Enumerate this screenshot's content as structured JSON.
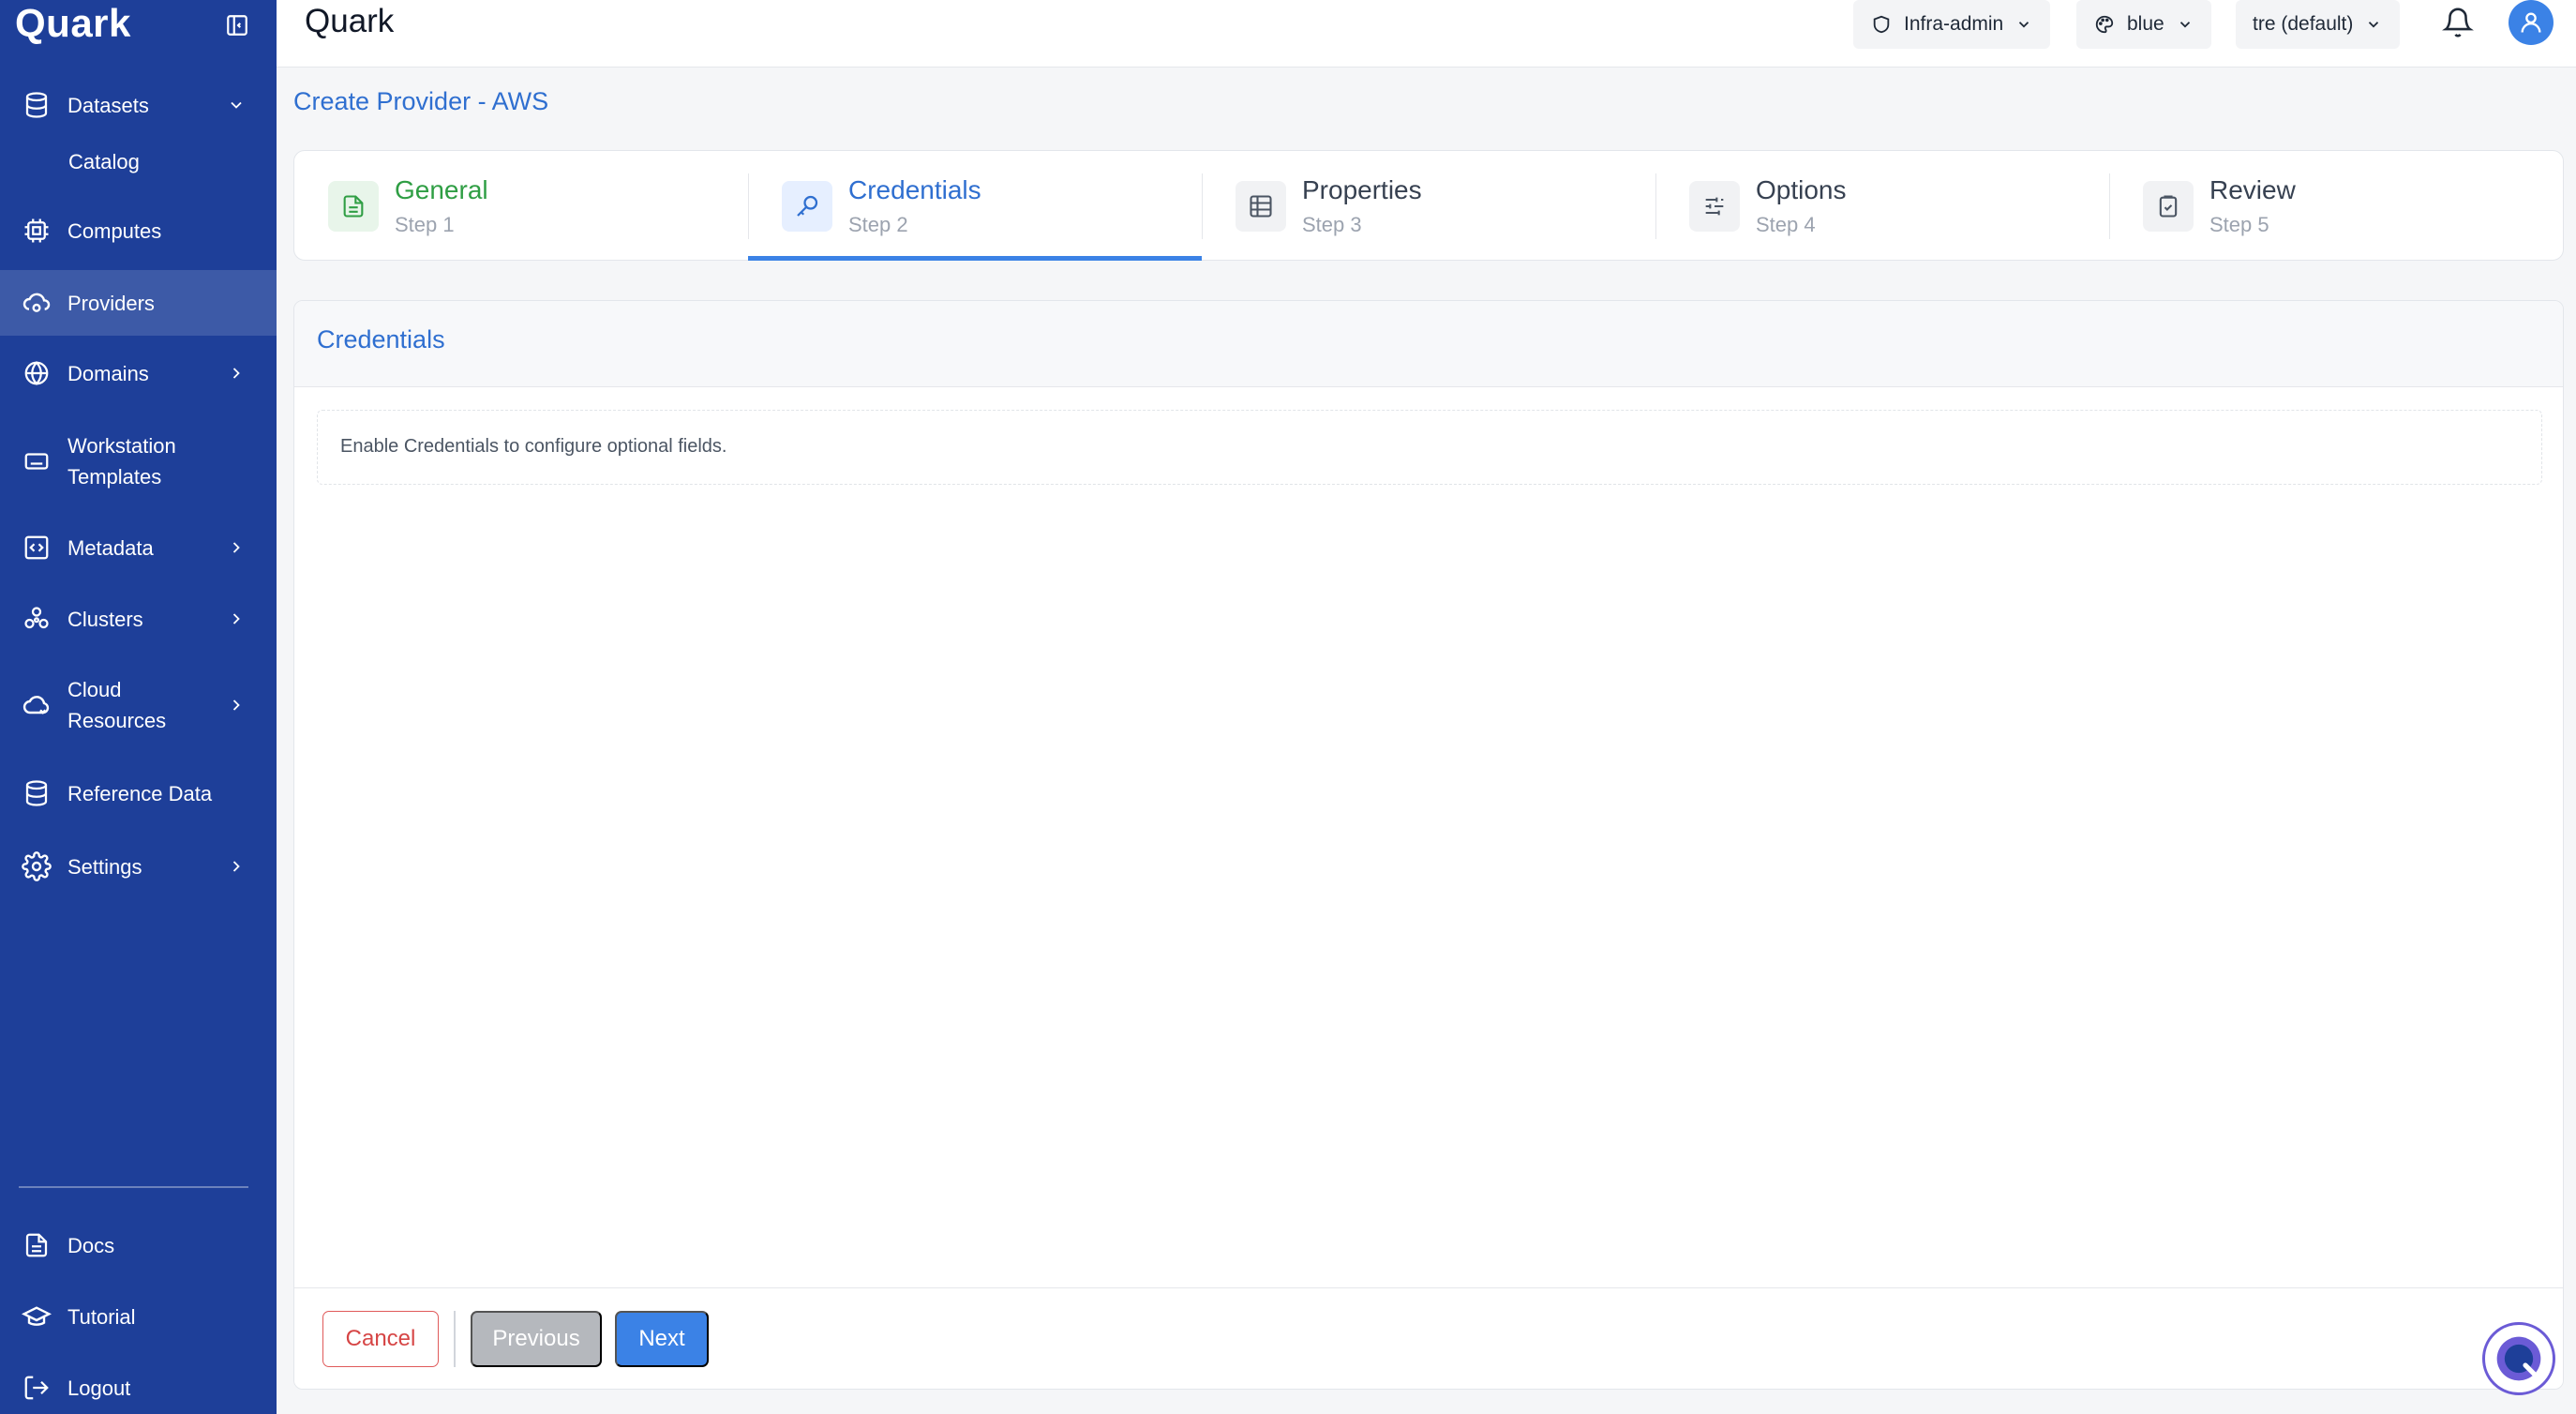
{
  "app": {
    "brand": "Quark",
    "title": "Quark"
  },
  "sidebar": {
    "items": [
      {
        "label": "Datasets",
        "icon": "database-icon",
        "expanded": true
      },
      {
        "label": "Catalog",
        "sub": true
      },
      {
        "label": "Computes",
        "icon": "cpu-icon"
      },
      {
        "label": "Providers",
        "icon": "cloud-cog-icon",
        "active": true
      },
      {
        "label": "Domains",
        "icon": "globe-icon"
      },
      {
        "label": "Workstation",
        "label2": "Templates",
        "icon": "keyboard-icon"
      },
      {
        "label": "Metadata",
        "icon": "code-square-icon"
      },
      {
        "label": "Clusters",
        "icon": "cluster-icon"
      },
      {
        "label": "Cloud",
        "label2": "Resources",
        "icon": "cloud-icon"
      },
      {
        "label": "Reference Data",
        "icon": "database-icon"
      },
      {
        "label": "Settings",
        "icon": "gear-icon"
      }
    ],
    "bottom": [
      {
        "label": "Docs",
        "icon": "document-icon"
      },
      {
        "label": "Tutorial",
        "icon": "graduation-cap-icon"
      },
      {
        "label": "Logout",
        "icon": "logout-icon"
      }
    ]
  },
  "topbar": {
    "role": "Infra-admin",
    "theme": "blue",
    "tenant": "tre (default)"
  },
  "page": {
    "title": "Create Provider - AWS"
  },
  "stepper": {
    "steps": [
      {
        "title": "General",
        "sub": "Step 1",
        "state": "done"
      },
      {
        "title": "Credentials",
        "sub": "Step 2",
        "state": "current"
      },
      {
        "title": "Properties",
        "sub": "Step 3",
        "state": "pending"
      },
      {
        "title": "Options",
        "sub": "Step 4",
        "state": "pending"
      },
      {
        "title": "Review",
        "sub": "Step 5",
        "state": "pending"
      }
    ]
  },
  "panel": {
    "title": "Credentials",
    "info": "Enable Credentials to configure optional fields."
  },
  "footer": {
    "cancel": "Cancel",
    "previous": "Previous",
    "next": "Next"
  },
  "colors": {
    "sidebar": "#1e3f99",
    "accent": "#3b82e6",
    "success": "#2f9e44",
    "danger": "#d64545"
  }
}
